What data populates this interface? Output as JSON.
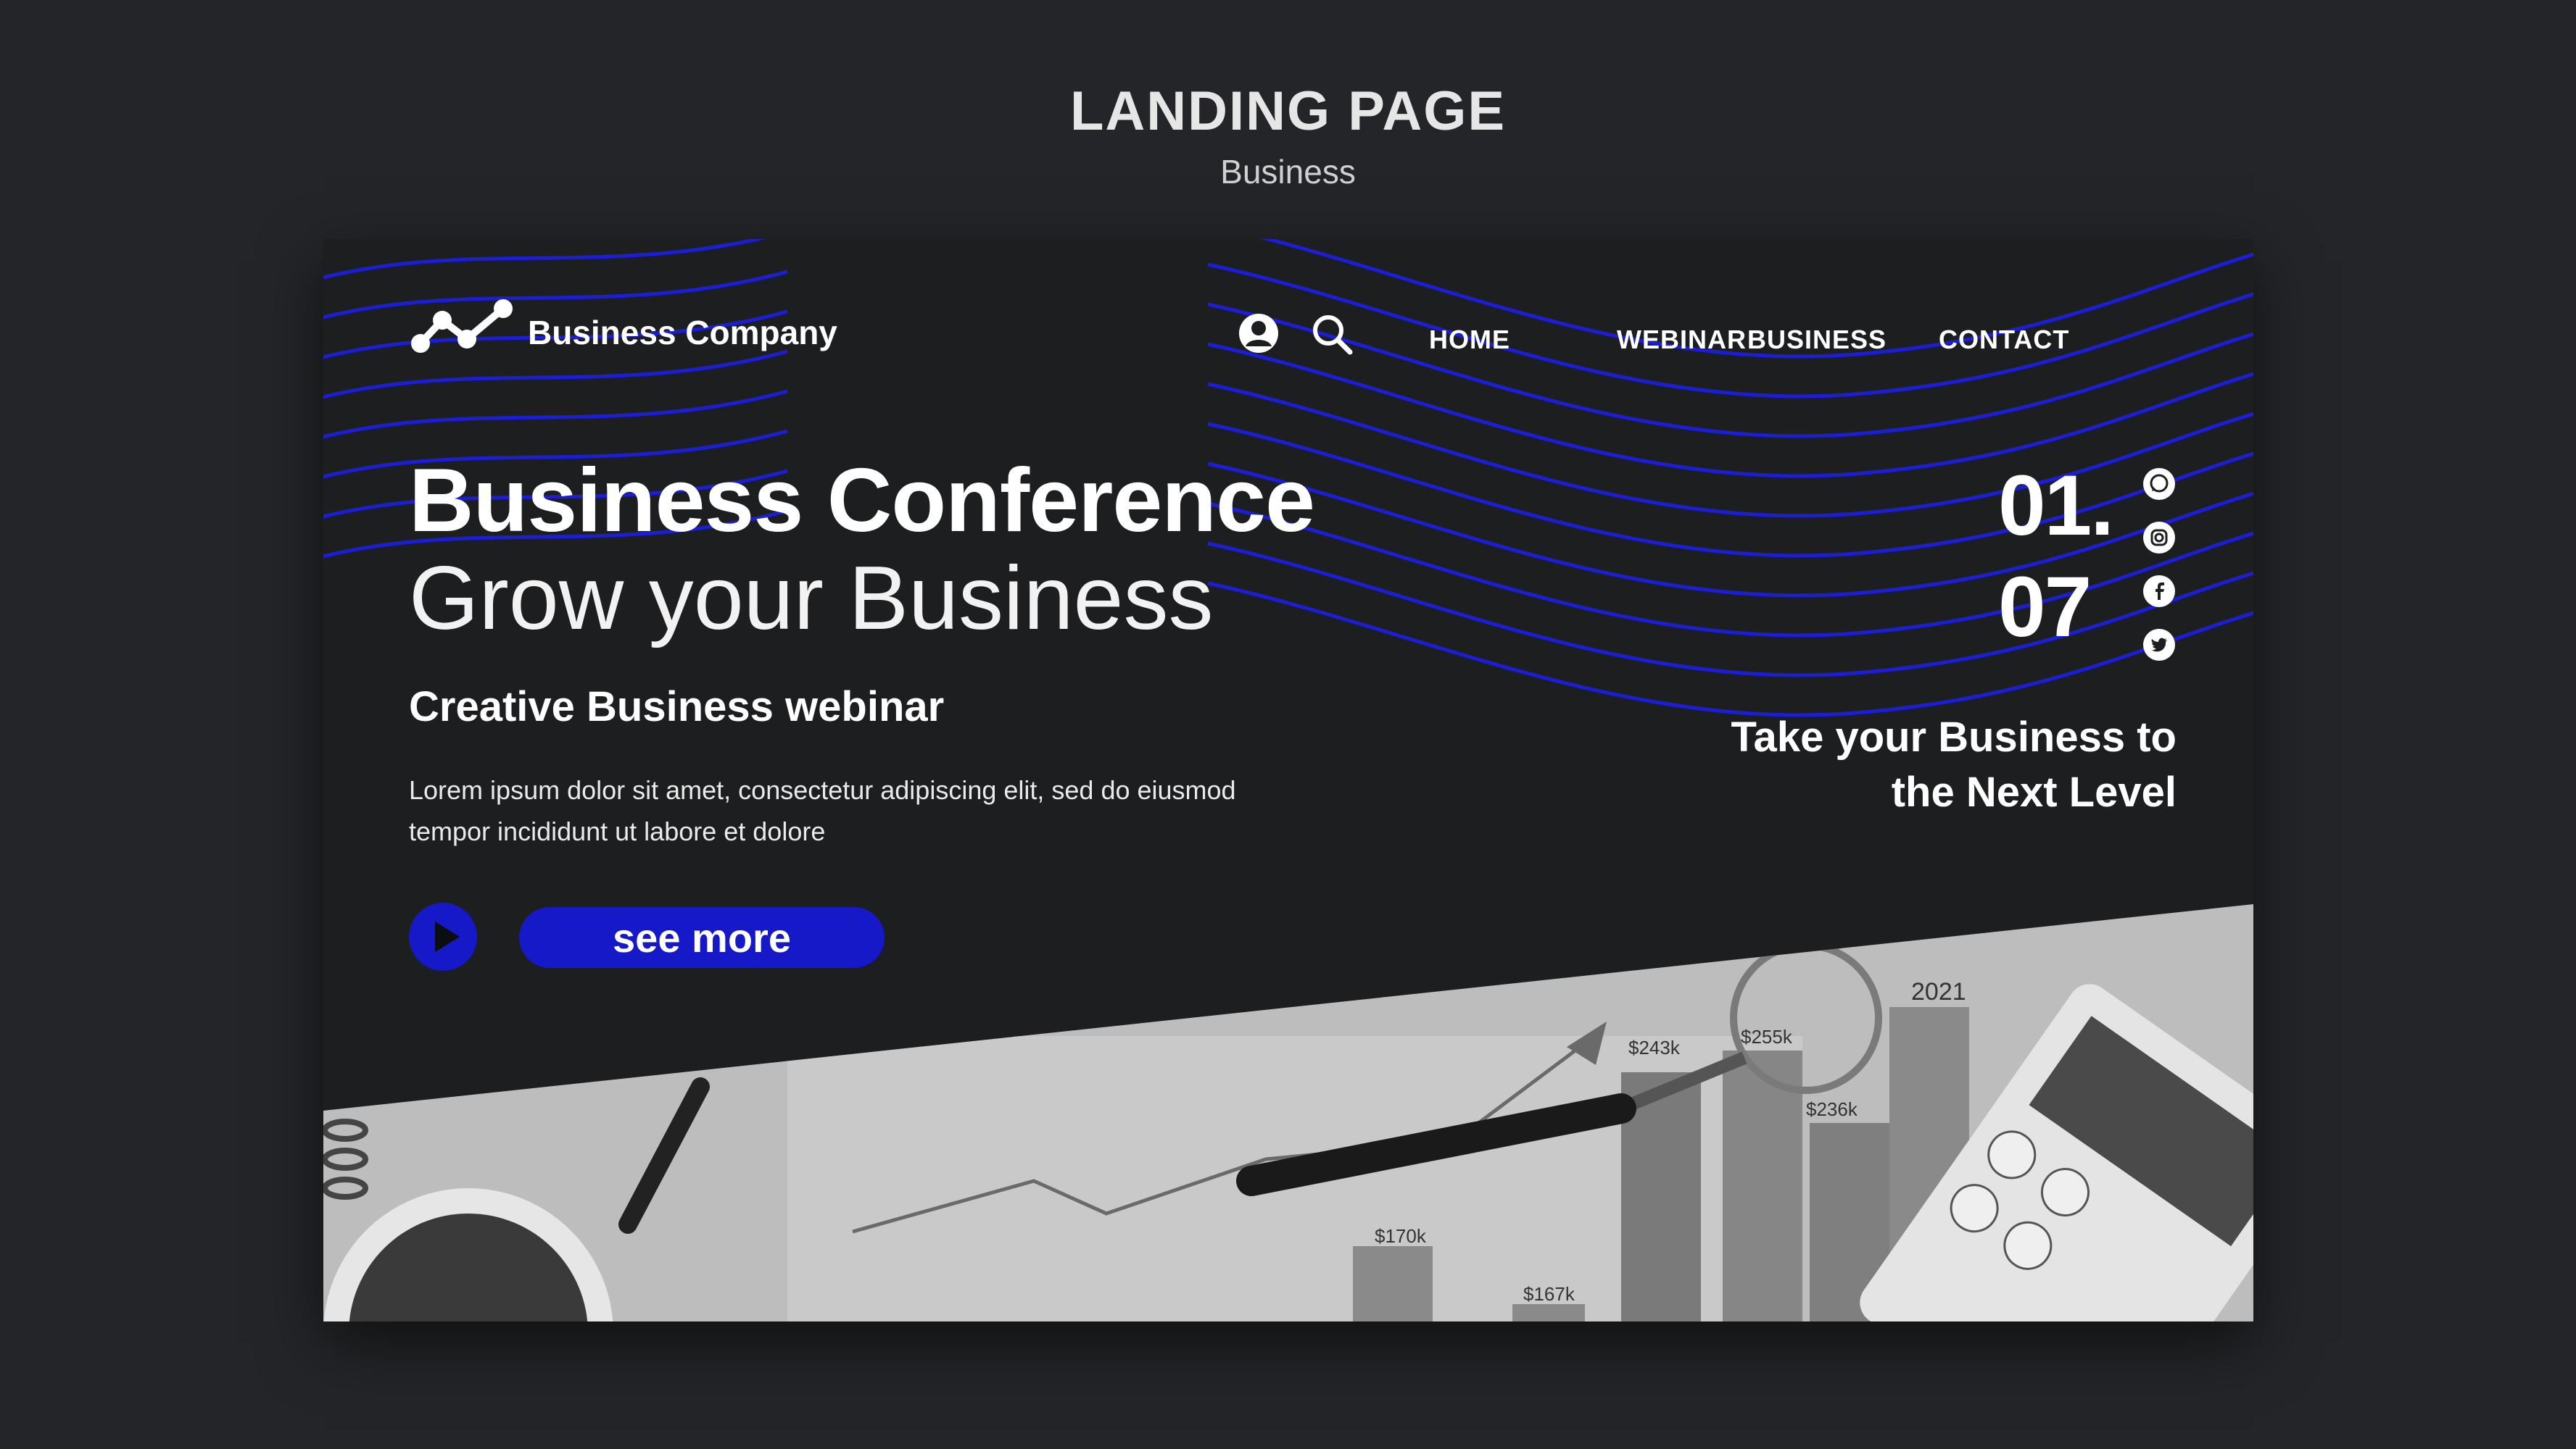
{
  "header": {
    "title": "LANDING PAGE",
    "subtitle": "Business"
  },
  "brand": {
    "name": "Business Company"
  },
  "nav": {
    "icons": [
      "user-icon",
      "search-icon"
    ],
    "items": [
      {
        "label": "HOME"
      },
      {
        "label": "WEBINAR"
      },
      {
        "label": "BUSINESS"
      },
      {
        "label": "CONTACT"
      }
    ]
  },
  "hero": {
    "title": "Business Conference",
    "subtitle": "Grow your Business",
    "tagline": "Creative Business webinar",
    "body": "Lorem ipsum dolor sit amet, consectetur adipiscing elit, sed do eiusmod tempor incididunt ut labore et dolore",
    "cta_label": "see more"
  },
  "slides": {
    "current": "01.",
    "total": "07"
  },
  "social": [
    "whatsapp-icon",
    "instagram-icon",
    "facebook-icon",
    "twitter-icon"
  ],
  "promo": {
    "line1": "Take your Business to",
    "line2": "the Next Level"
  },
  "photo_labels": {
    "year": "2021",
    "values": [
      "$243k",
      "$255k",
      "$236k",
      "$170k",
      "$167k"
    ]
  },
  "colors": {
    "accent": "#1519c7",
    "background": "#242528",
    "card": "#1d1e20"
  }
}
